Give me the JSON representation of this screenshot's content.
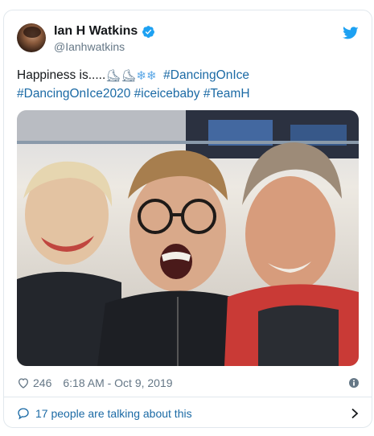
{
  "user": {
    "display_name": "Ian H Watkins",
    "handle": "@Ianhwatkins"
  },
  "tweet": {
    "text_start": "Happiness is.....",
    "emoji": [
      "⛸",
      "⛸",
      "❄",
      "❄"
    ],
    "hashtags_line1": "#DancingOnIce",
    "hashtags_line2": [
      "#DancingOnIce2020",
      "#iceicebaby",
      "#TeamH"
    ]
  },
  "meta": {
    "likes": "246",
    "timestamp": "6:18 AM - Oct 9, 2019"
  },
  "talking": {
    "label": "17 people are talking about this"
  },
  "colors": {
    "link": "#1b6aa5",
    "twitter_blue": "#1da1f2",
    "muted": "#657786",
    "border": "#e1e8ed"
  },
  "icons": [
    "verified-badge-icon",
    "twitter-bird-icon",
    "heart-icon",
    "info-icon",
    "speech-bubble-icon",
    "chevron-right-icon"
  ]
}
